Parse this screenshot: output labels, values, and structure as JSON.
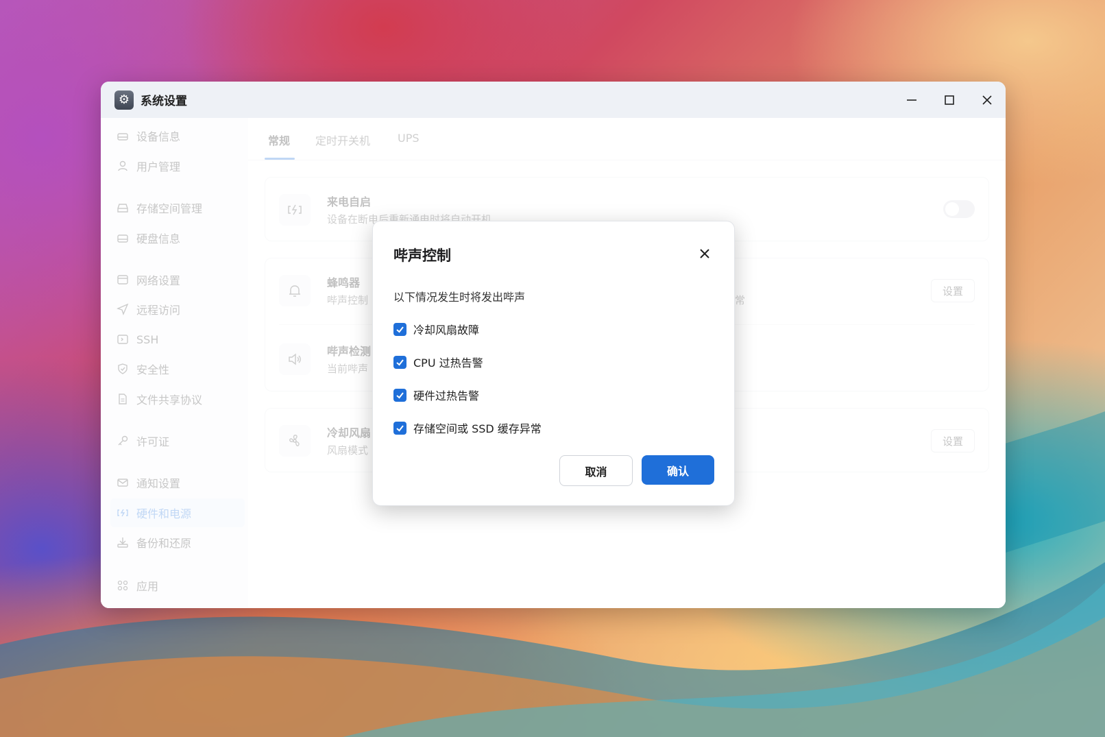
{
  "window": {
    "title": "系统设置"
  },
  "sidebar": {
    "items": [
      {
        "label": "设备信息",
        "icon": "device-icon"
      },
      {
        "label": "用户管理",
        "icon": "user-icon"
      },
      {
        "label": "存储空间管理",
        "icon": "storage-icon"
      },
      {
        "label": "硬盘信息",
        "icon": "disk-icon"
      },
      {
        "label": "网络设置",
        "icon": "network-icon"
      },
      {
        "label": "远程访问",
        "icon": "send-icon"
      },
      {
        "label": "SSH",
        "icon": "ssh-icon"
      },
      {
        "label": "安全性",
        "icon": "shield-icon"
      },
      {
        "label": "文件共享协议",
        "icon": "file-icon"
      },
      {
        "label": "许可证",
        "icon": "key-icon"
      },
      {
        "label": "通知设置",
        "icon": "mail-icon"
      },
      {
        "label": "硬件和电源",
        "icon": "power-icon"
      },
      {
        "label": "备份和还原",
        "icon": "download-icon"
      },
      {
        "label": "应用",
        "icon": "apps-icon"
      }
    ],
    "active_index": 11
  },
  "tabs": [
    "常规",
    "定时开关机",
    "UPS"
  ],
  "settings": {
    "auto_power": {
      "title": "来电自启",
      "desc": "设备在断电后重新通电时将自动开机",
      "enabled": false
    },
    "buzzer": {
      "title": "蜂鸣器",
      "desc": "哔声控制",
      "desc_tail": "常",
      "button": "设置"
    },
    "beep_test": {
      "title": "哔声检测",
      "desc": "当前哔声"
    },
    "fan": {
      "title": "冷却风扇",
      "desc": "风扇模式",
      "button": "设置"
    }
  },
  "dialog": {
    "title": "哔声控制",
    "desc": "以下情况发生时将发出哔声",
    "options": [
      {
        "label": "冷却风扇故障",
        "checked": true
      },
      {
        "label": "CPU 过热告警",
        "checked": true
      },
      {
        "label": "硬件过热告警",
        "checked": true
      },
      {
        "label": "存储空间或 SSD 缓存异常",
        "checked": true
      }
    ],
    "cancel": "取消",
    "confirm": "确认"
  },
  "colors": {
    "accent": "#1f6fd9"
  }
}
